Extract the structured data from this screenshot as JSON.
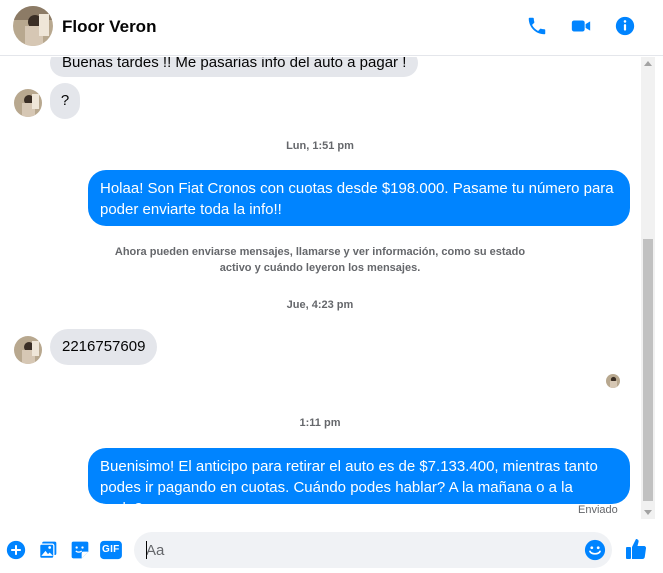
{
  "header": {
    "contact_name": "Floor Veron",
    "accent_color": "#0084ff"
  },
  "messages": [
    {
      "id": "m1",
      "direction": "in",
      "text": "Buenas tardes !! Me pasarias info del auto a pagar !"
    },
    {
      "id": "m2",
      "direction": "in",
      "text": "?"
    },
    {
      "id": "t1",
      "type": "timestamp",
      "text": "Lun, 1:51 pm"
    },
    {
      "id": "m3",
      "direction": "out",
      "text": "Holaa! Son Fiat Cronos con cuotas desde $198.000. Pasame tu número para poder enviarte toda la info!!"
    },
    {
      "id": "s1",
      "type": "system",
      "text": "Ahora pueden enviarse mensajes, llamarse y ver información, como su estado activo y cuándo leyeron los mensajes."
    },
    {
      "id": "t2",
      "type": "timestamp",
      "text": "Jue, 4:23 pm"
    },
    {
      "id": "m4",
      "direction": "in",
      "text": "2216757609"
    },
    {
      "id": "t3",
      "type": "timestamp",
      "text": "1:11 pm"
    },
    {
      "id": "m5",
      "direction": "out",
      "text": "Buenisimo! El anticipo para retirar el auto es de $7.133.400, mientras tanto podes ir pagando en cuotas. Cuándo podes hablar? A la mañana o a la tarde?"
    }
  ],
  "status": {
    "sent_label": "Enviado"
  },
  "composer": {
    "placeholder": "Aa",
    "gif_label": "GIF"
  },
  "icons": {
    "call": "phone-icon",
    "video": "video-camera-icon",
    "info": "info-icon",
    "more": "plus-circle-icon",
    "photo": "photo-icon",
    "sticker": "sticker-icon",
    "gif": "gif-icon",
    "emoji": "emoji-icon",
    "like": "thumbs-up-icon"
  }
}
